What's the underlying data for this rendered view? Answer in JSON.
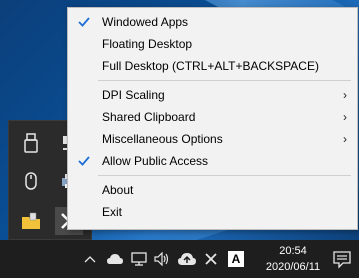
{
  "menu": {
    "items": [
      {
        "label": "Windowed Apps",
        "checked": true,
        "submenu": false
      },
      {
        "label": "Floating Desktop",
        "checked": false,
        "submenu": false
      },
      {
        "label": "Full Desktop (CTRL+ALT+BACKSPACE)",
        "checked": false,
        "submenu": false
      }
    ],
    "items2": [
      {
        "label": "DPI Scaling",
        "submenu": true
      },
      {
        "label": "Shared Clipboard",
        "submenu": true
      },
      {
        "label": "Miscellaneous Options",
        "submenu": true
      },
      {
        "label": "Allow Public Access",
        "checked": true,
        "submenu": false
      }
    ],
    "items3": [
      {
        "label": "About"
      },
      {
        "label": "Exit"
      }
    ],
    "arrow_glyph": "›",
    "check_color": "#1f6fd6"
  },
  "taskbar": {
    "time": "20:54",
    "date": "2020/06/11",
    "chevron_glyph": "^",
    "volume_glyph": "🔊",
    "ime_glyph": "A",
    "background": "#1e1e1e"
  },
  "tray_overflow": {
    "background": "#2b2b2b"
  }
}
